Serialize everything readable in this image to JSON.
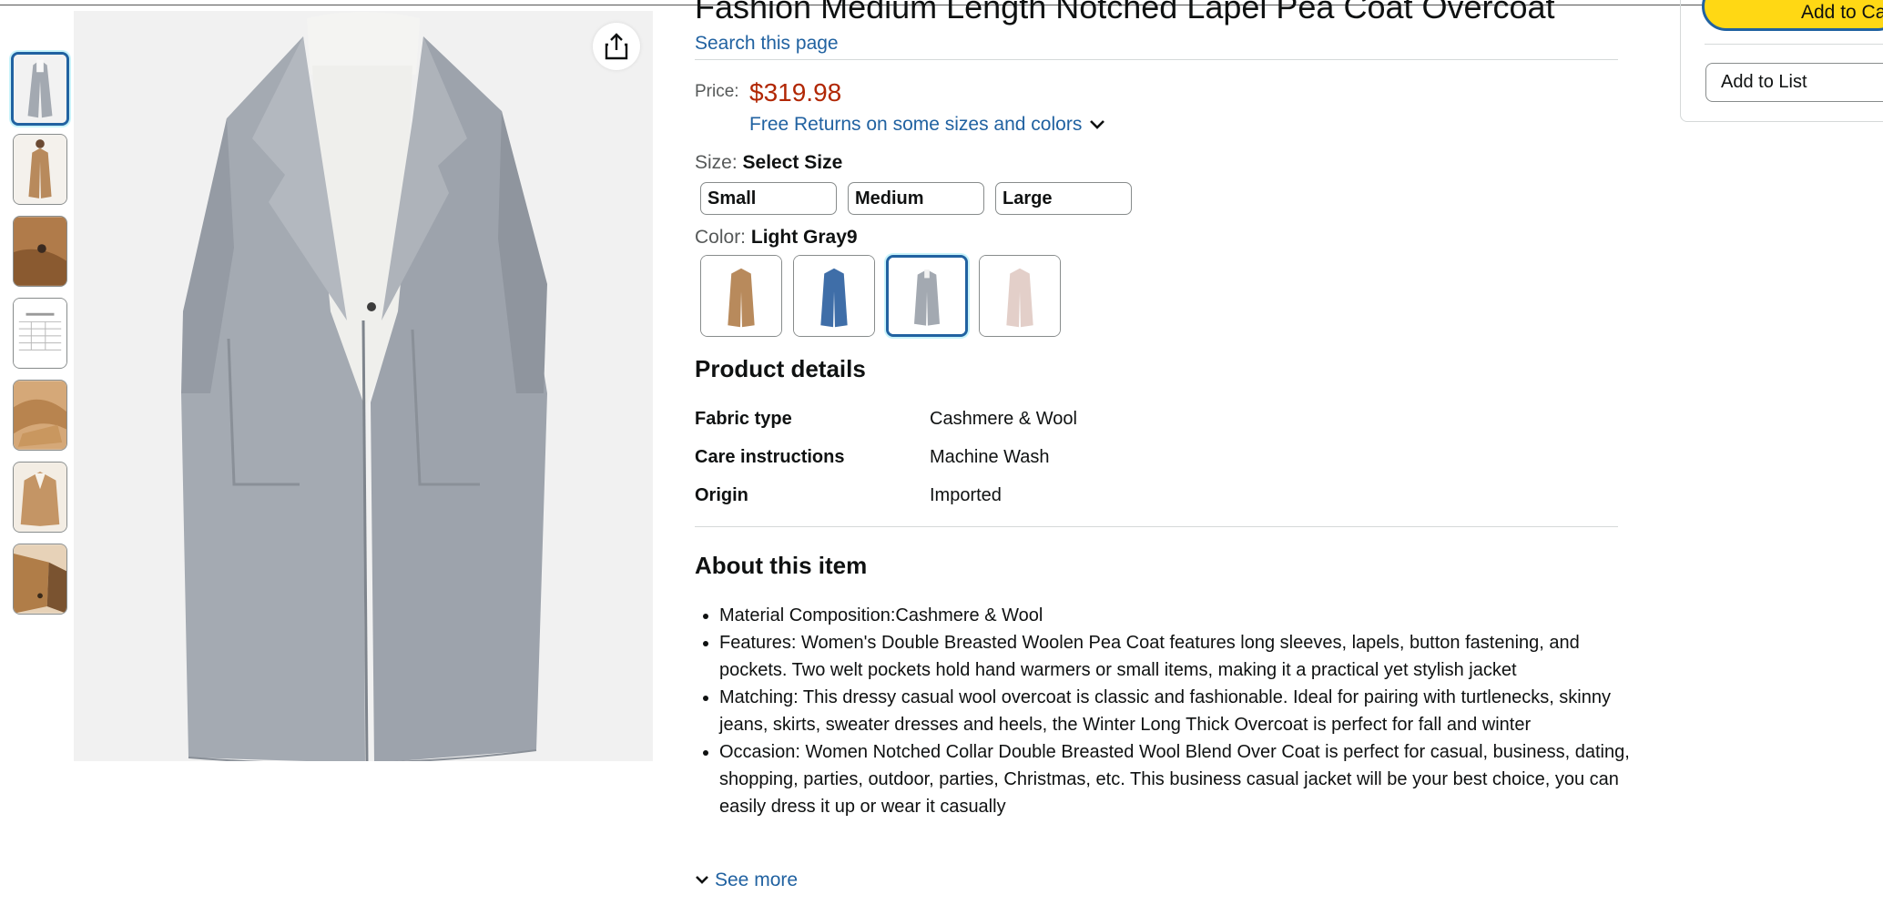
{
  "product": {
    "title": "Fashion Medium Length Notched Lapel Pea Coat Overcoat",
    "search_link": "Search this page",
    "price_label": "Price:",
    "price": "$319.98",
    "free_returns": "Free Returns on some sizes and colors",
    "size_label": "Size:",
    "size_selected": "Select Size",
    "sizes": [
      "Small",
      "Medium",
      "Large"
    ],
    "color_label": "Color:",
    "color_selected": "Light Gray9",
    "color_swatches": [
      "camel",
      "blue",
      "light-gray",
      "pink"
    ]
  },
  "details": {
    "heading": "Product details",
    "rows": [
      {
        "key": "Fabric type",
        "value": "Cashmere & Wool"
      },
      {
        "key": "Care instructions",
        "value": "Machine Wash"
      },
      {
        "key": "Origin",
        "value": "Imported"
      }
    ]
  },
  "about": {
    "heading": "About this item",
    "bullets": [
      "Material Composition:Cashmere & Wool",
      "Features: Women's Double Breasted Woolen Pea Coat features long sleeves, lapels, button fastening, and pockets. Two welt pockets hold hand warmers or small items, making it a practical yet stylish jacket",
      "Matching: This dressy casual wool overcoat is classic and fashionable. Ideal for pairing with turtlenecks, skinny jeans, skirts, sweater dresses and heels, the Winter Long Thick Overcoat is perfect for fall and winter",
      "Occasion: Women Notched Collar Double Breasted Wool Blend Over Coat is perfect for casual, business, dating, shopping, parties, outdoor, parties, Christmas, etc. This business casual jacket will be your best choice, you can easily dress it up or wear it casually"
    ],
    "see_more": "See more"
  },
  "buybox": {
    "add_to_cart": "Add to Cart",
    "add_to_list": "Add to List"
  },
  "gallery": {
    "thumbnails": [
      "gray-coat-front",
      "camel-coat-model",
      "camel-button-detail",
      "size-chart",
      "camel-fabric-fold",
      "camel-coat-hanger",
      "camel-coat-detail"
    ],
    "selected_index": 0
  },
  "colors": {
    "link": "#2162a1",
    "price": "#b12704",
    "add_to_cart_bg": "#ffd814",
    "coat_gray": "#a3a9b1",
    "coat_camel": "#b88a5c"
  }
}
